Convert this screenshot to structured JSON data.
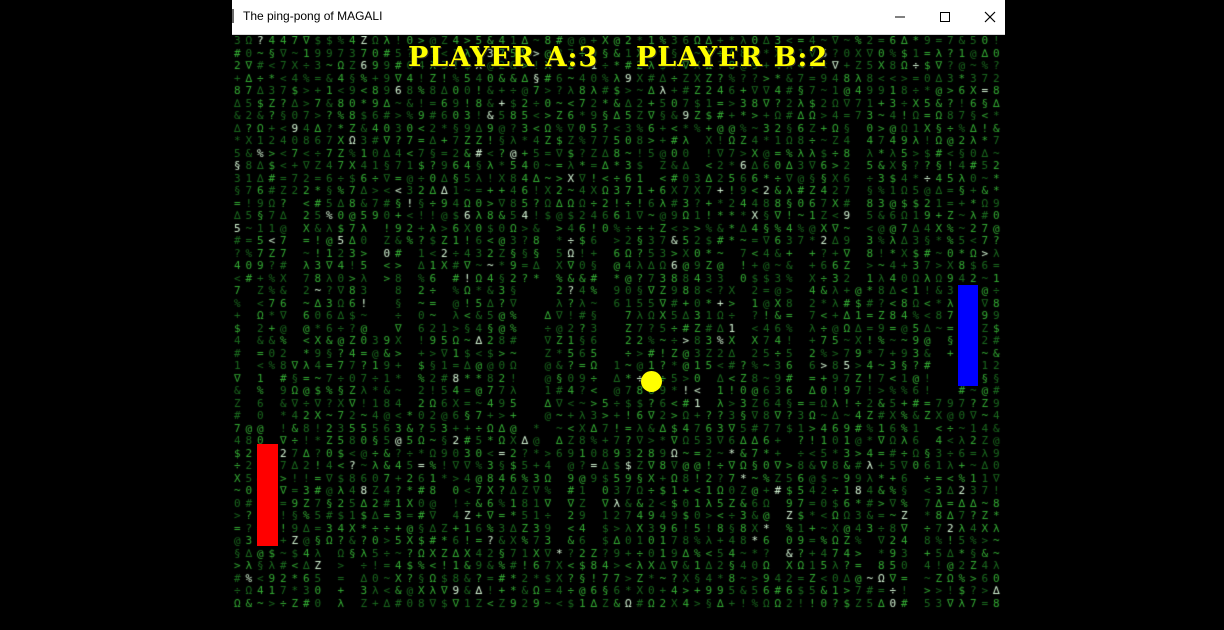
{
  "window": {
    "title": "The ping-pong of MAGALI",
    "controls": {
      "minimize": "—",
      "maximize": "☐",
      "close": "✕"
    }
  },
  "game": {
    "score_a": "PLAYER A:3",
    "score_b": "PLAYER B:2",
    "colors": {
      "background": "#000000",
      "matrix_green": "#27c12b",
      "score": "#ffff00",
      "left_paddle": "#ff0000",
      "right_paddle": "#0000ff",
      "ball": "#ffff00"
    }
  }
}
